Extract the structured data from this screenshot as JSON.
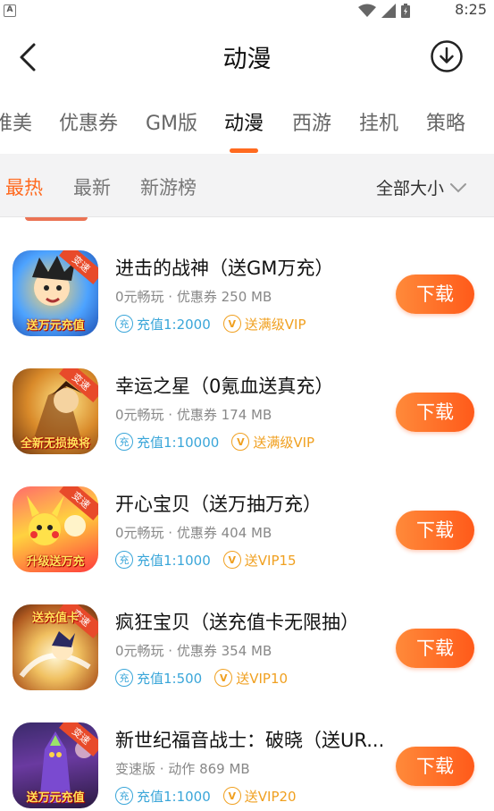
{
  "status_bar": {
    "time": "8:25",
    "notification_glyph": "A"
  },
  "header": {
    "title": "动漫"
  },
  "tabs": [
    {
      "label": "唯美"
    },
    {
      "label": "优惠券"
    },
    {
      "label": "GM版"
    },
    {
      "label": "动漫"
    },
    {
      "label": "西游"
    },
    {
      "label": "挂机"
    },
    {
      "label": "策略"
    }
  ],
  "active_tab": "动漫",
  "filters": [
    {
      "label": "最热"
    },
    {
      "label": "最新"
    },
    {
      "label": "新游榜"
    }
  ],
  "active_filter": "最热",
  "size_filter": {
    "label": "全部大小"
  },
  "colors": {
    "accent": "#ff6a1f",
    "tag_blue": "#3aa6d9",
    "tag_gold": "#f0a020"
  },
  "badge_text": "变速",
  "apps": [
    {
      "name": "进击的战神（送GM万充）",
      "meta": "0元畅玩 · 优惠券  250 MB",
      "charge": "充值1:2000",
      "vip": "送满级VIP",
      "button": "下载",
      "icon_caption": "送万元充值"
    },
    {
      "name": "幸运之星（0氪血送真充）",
      "meta": "0元畅玩 · 优惠券  174 MB",
      "charge": "充值1:10000",
      "vip": "送满级VIP",
      "button": "下载",
      "icon_caption": "全新无损换将"
    },
    {
      "name": "开心宝贝（送万抽万充）",
      "meta": "0元畅玩 · 优惠券  404 MB",
      "charge": "充值1:1000",
      "vip": "送VIP15",
      "button": "下载",
      "icon_caption": "升级送万充"
    },
    {
      "name": "疯狂宝贝（送充值卡无限抽）",
      "meta": "0元畅玩 · 优惠券  354 MB",
      "charge": "充值1:500",
      "vip": "送VIP10",
      "button": "下载",
      "icon_caption": "送充值卡"
    },
    {
      "name": "新世纪福音战士：破晓（送UR...",
      "meta": "变速版 · 动作  869 MB",
      "charge": "充值1:1000",
      "vip": "送VIP20",
      "button": "下载",
      "icon_caption": "送万元充值"
    }
  ],
  "tag_glyphs": {
    "charge": "充",
    "vip": "V"
  }
}
